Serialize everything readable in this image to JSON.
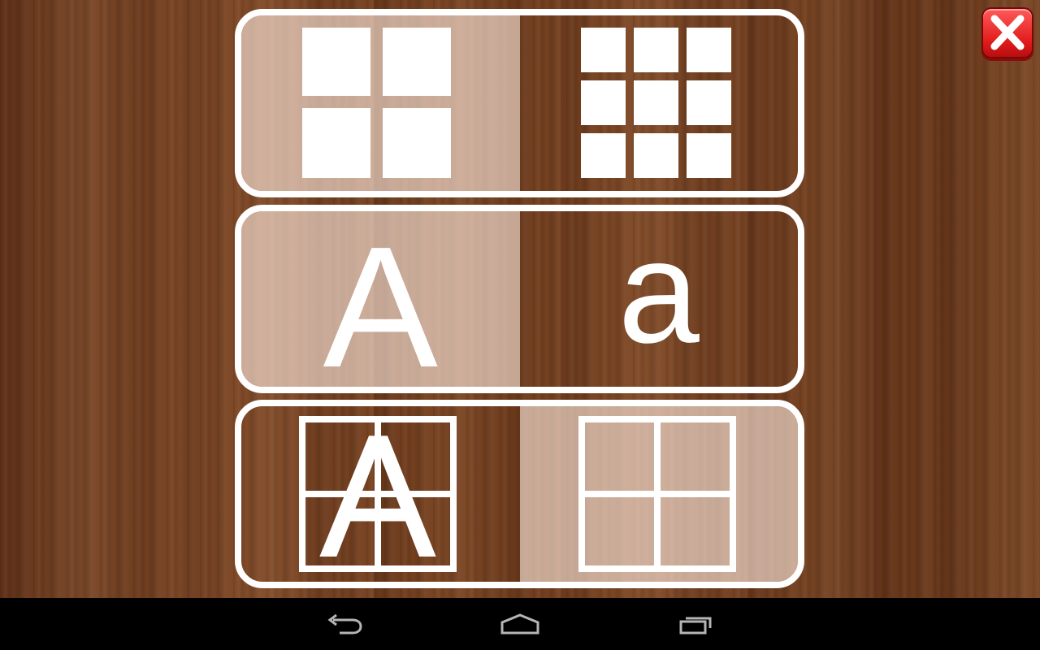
{
  "app": {
    "background": "wood",
    "accent_color": "#ffffff",
    "close_button_color": "#e8262a"
  },
  "options": [
    {
      "id": "grid-size",
      "left_icon": "grid-2x2-icon",
      "right_icon": "grid-3x3-icon",
      "selected": "left"
    },
    {
      "id": "letter-case",
      "left_label": "A",
      "right_label": "a",
      "selected": "left"
    },
    {
      "id": "display-mode",
      "left_label": "A",
      "left_icon": "letter-on-grid-icon",
      "right_icon": "empty-grid-icon",
      "selected": "right"
    }
  ],
  "close_icon": "close-icon",
  "navbar": {
    "icons": [
      "back-icon",
      "home-icon",
      "recent-apps-icon"
    ]
  }
}
